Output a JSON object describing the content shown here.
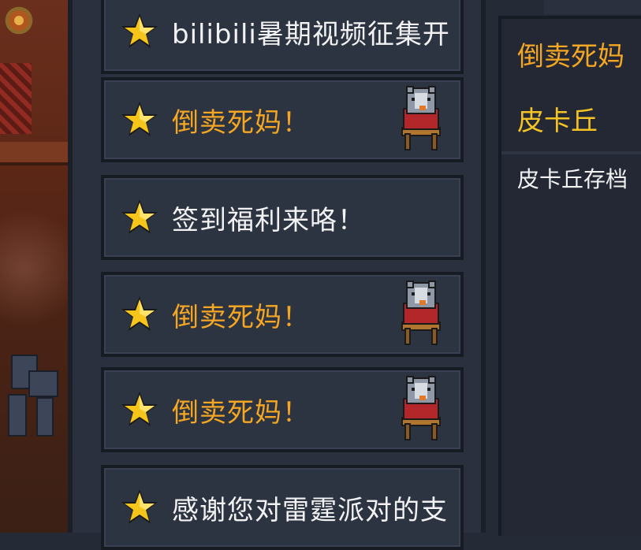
{
  "mail_list": {
    "items": [
      {
        "label": "bilibili暑期视频征集开",
        "color": "white",
        "has_pet": false,
        "icon": "star-icon"
      },
      {
        "label": "倒卖死妈！",
        "color": "orange",
        "has_pet": true,
        "icon": "star-icon"
      },
      {
        "label": "签到福利来咯！",
        "color": "white",
        "has_pet": false,
        "icon": "star-icon"
      },
      {
        "label": "倒卖死妈！",
        "color": "orange",
        "has_pet": true,
        "icon": "star-icon"
      },
      {
        "label": "倒卖死妈！",
        "color": "orange",
        "has_pet": true,
        "icon": "star-icon"
      },
      {
        "label": "感谢您对雷霆派对的支",
        "color": "white",
        "has_pet": false,
        "icon": "star-icon"
      }
    ]
  },
  "detail": {
    "title": "倒卖死妈",
    "sender": "皮卡丘",
    "body": "皮卡丘存档"
  },
  "colors": {
    "highlight": "#f5a623",
    "normal_text": "#f2f2f2",
    "panel_bg": "#2c3341"
  }
}
